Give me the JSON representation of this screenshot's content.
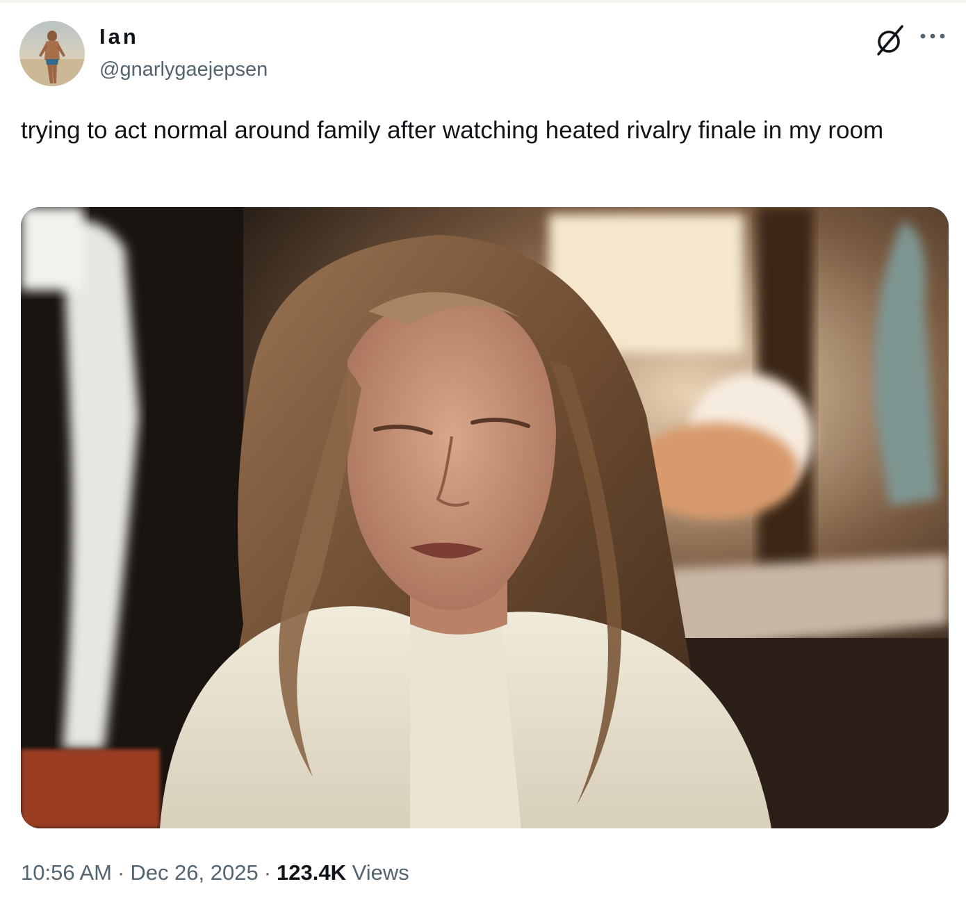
{
  "author": {
    "display_name": "Ian",
    "handle": "@gnarlygaejepsen"
  },
  "post": {
    "text": "trying to act normal around family after watching heated rivalry finale in my room",
    "media_icon": "photo-of-woman-in-cafe",
    "time": "10:56 AM",
    "date": "Dec 26, 2025",
    "separator": "·",
    "views_count": "123.4K",
    "views_label": "Views"
  },
  "header_actions": {
    "grok_icon": "grok-icon",
    "more_icon": "more-icon"
  },
  "colors": {
    "text_primary": "#0f1419",
    "text_secondary": "#536471",
    "background": "#ffffff"
  }
}
